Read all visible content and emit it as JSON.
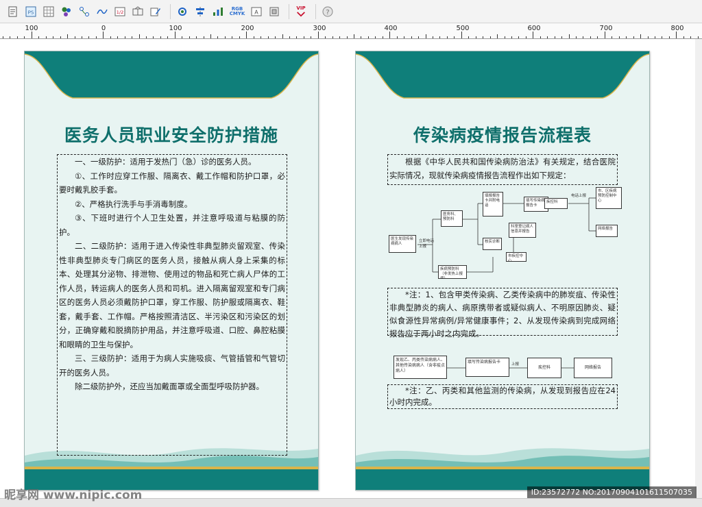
{
  "toolbar": {
    "items": [
      {
        "icon": "document-icon"
      },
      {
        "icon": "photoshop-icon"
      },
      {
        "icon": "grid-icon"
      },
      {
        "icon": "color-dots-icon"
      },
      {
        "icon": "node-icon"
      },
      {
        "icon": "curve-icon"
      },
      {
        "icon": "number-box-icon",
        "text": "1/2"
      },
      {
        "icon": "frame-icon"
      },
      {
        "icon": "edit-icon"
      },
      {
        "icon": "settings-icon"
      },
      {
        "icon": "align-icon"
      },
      {
        "icon": "distribute-icon"
      },
      {
        "icon": "rgb-cmyk-icon",
        "text_top": "RGB",
        "text_bottom": "CMYK"
      },
      {
        "icon": "text-box-icon"
      },
      {
        "icon": "layer-icon"
      },
      {
        "icon": "vip-icon",
        "text": "VIP"
      },
      {
        "icon": "help-icon"
      }
    ],
    "colors": {
      "vip": "#c8102e",
      "rgb": "#2d6fd0",
      "cmyk": "#2d6fd0"
    }
  },
  "ruler": {
    "labels": [
      "100",
      "0",
      "100",
      "200",
      "300",
      "400",
      "500",
      "600",
      "700",
      "800"
    ]
  },
  "colors": {
    "teal": "#0f7f7a",
    "dark_teal": "#0d6e6a",
    "gold": "#d9b54a",
    "page_bg": "#e8f4f2"
  },
  "page1": {
    "title": "医务人员职业安全防护措施",
    "paragraphs": [
      "一、一级防护：适用于发热门（急）诊的医务人员。",
      "①、工作时应穿工作服、隔离衣、戴工作帽和防护口罩，必要时戴乳胶手套。",
      "②、严格执行洗手与手消毒制度。",
      "③、下班时进行个人卫生处置，并注意呼吸道与粘膜的防护。",
      "二、二级防护：适用于进入传染性非典型肺炎留观室、传染性非典型肺炎专门病区的医务人员，接触从病人身上采集的标本、处理其分泌物、排泄物、使用过的物品和死亡病人尸体的工作人员，转运病人的医务人员和司机。进入隔离留观室和专门病区的医务人员必须戴防护口罩，穿工作服、防护服或隔离衣、鞋套，戴手套、工作帽。严格按照清洁区、半污染区和污染区的划分，正确穿戴和脱摘防护用品，并注意呼吸道、口腔、鼻腔粘膜和眼睛的卫生与保护。",
      "三、三级防护：适用于为病人实施吸痰、气管插管和气管切开的医务人员。",
      "除二级防护外，还应当加戴面罩或全面型呼吸防护器。"
    ]
  },
  "page2": {
    "title": "传染病疫情报告流程表",
    "intro": "根据《中华人民共和国传染病防治法》有关规定，结合医院实际情况，现就传染病疫情报告流程作出如下规定：",
    "flow1": {
      "start": "医生发现传染病病人",
      "arrow_start": "立即电话上报",
      "dept": "医务科、预防科",
      "n_top": "填报报告卡并附电话",
      "n_verify": "核实诊断",
      "n_card": "填写传染病报告卡",
      "n_internal": "科室登记病人信息并报告",
      "n_report": "网络直报",
      "n_city": "市、区疾病预防控制中心",
      "n_cdc": "疾控科",
      "n_bottom": "疾病预防科（非发热上报病）",
      "n_final": "市疾控中心",
      "n_online": "网络报告",
      "arrow_up": "电话上报"
    },
    "note1": "*注：1、包含甲类传染病、乙类传染病中的肺炭疽、传染性非典型肺炎的病人、病原携带者或疑似病人、不明原因肺炎、疑似食源性异常病例/异常健康事件；2、从发现传染病到完成网络报告应于两小时之内完成。",
    "flow2": {
      "n1": "发现乙、丙类传染病病人、其他传染病病人（含非疫点病人）",
      "n2": "填写传染病报告卡",
      "arrow": "上报",
      "n3": "疾控科",
      "n4": "网络报告"
    },
    "note2": "*注：乙、丙类和其他监测的传染病，从发现到报告应在24小时内完成。"
  },
  "watermark": {
    "site": "昵享网 www.nipic.com",
    "id": "ID:23572772 NO:20170904101611507035"
  }
}
